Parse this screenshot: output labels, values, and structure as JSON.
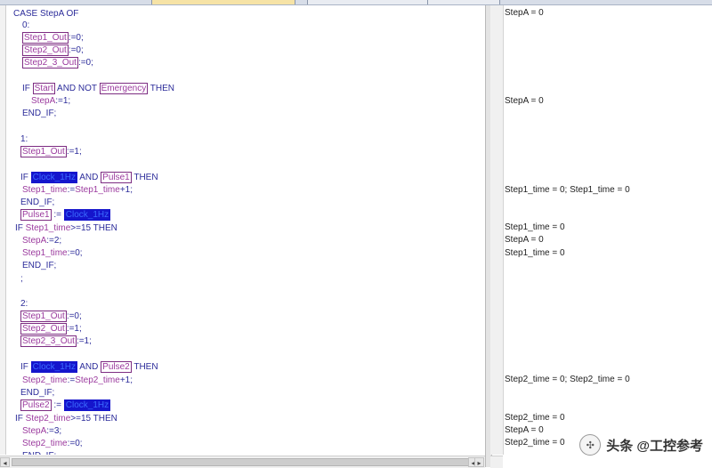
{
  "code_lines": [
    {
      "text": "CASE StepA OF"
    },
    {
      "text": "0:"
    },
    {
      "parts": [
        {
          "t": "Step1_Out",
          "c": "boxed"
        },
        {
          "t": ":=0;",
          "c": "kw"
        }
      ]
    },
    {
      "parts": [
        {
          "t": "Step2_Out",
          "c": "boxed"
        },
        {
          "t": ":=0;",
          "c": "kw"
        }
      ]
    },
    {
      "parts": [
        {
          "t": "Step2_3_Out",
          "c": "boxed"
        },
        {
          "t": ":=0;",
          "c": "kw"
        }
      ]
    },
    {
      "parts": [
        {
          "t": "IF ",
          "c": "kw"
        },
        {
          "t": "Start",
          "c": "boxed"
        },
        {
          "t": " AND NOT ",
          "c": "kw"
        },
        {
          "t": "Emergency",
          "c": "boxed"
        },
        {
          "t": " THEN",
          "c": "kw"
        }
      ]
    },
    {
      "parts": [
        {
          "t": "StepA",
          "c": "var"
        },
        {
          "t": ":=1;",
          "c": "kw"
        }
      ]
    },
    {
      "text": "END_IF;"
    },
    {
      "text": "1:"
    },
    {
      "parts": [
        {
          "t": "Step1_Out",
          "c": "boxed"
        },
        {
          "t": ":=1;",
          "c": "kw"
        }
      ]
    },
    {
      "parts": [
        {
          "t": "IF ",
          "c": "kw"
        },
        {
          "t": "Clock_1Hz",
          "c": "hl"
        },
        {
          "t": " AND ",
          "c": "kw"
        },
        {
          "t": "Pulse1",
          "c": "boxed"
        },
        {
          "t": " THEN",
          "c": "kw"
        }
      ]
    },
    {
      "parts": [
        {
          "t": "Step1_time",
          "c": "var"
        },
        {
          "t": ":=",
          "c": "kw"
        },
        {
          "t": "Step1_time",
          "c": "var"
        },
        {
          "t": "+1;",
          "c": "kw"
        }
      ]
    },
    {
      "text": "END_IF;"
    },
    {
      "parts": [
        {
          "t": "Pulse1",
          "c": "boxed"
        },
        {
          "t": " := ",
          "c": "kw"
        },
        {
          "t": "Clock_1Hz",
          "c": "hl"
        }
      ]
    },
    {
      "parts": [
        {
          "t": "IF ",
          "c": "kw"
        },
        {
          "t": "Step1_time",
          "c": "var"
        },
        {
          "t": ">=15 THEN",
          "c": "kw"
        }
      ]
    },
    {
      "parts": [
        {
          "t": "StepA",
          "c": "var"
        },
        {
          "t": ":=2;",
          "c": "kw"
        }
      ]
    },
    {
      "parts": [
        {
          "t": "Step1_time",
          "c": "var"
        },
        {
          "t": ":=0;",
          "c": "kw"
        }
      ]
    },
    {
      "text": "END_IF;"
    },
    {
      "text": ";"
    },
    {
      "text": "2:"
    },
    {
      "parts": [
        {
          "t": "Step1_Out",
          "c": "boxed"
        },
        {
          "t": ":=0;",
          "c": "kw"
        }
      ]
    },
    {
      "parts": [
        {
          "t": "Step2_Out",
          "c": "boxed"
        },
        {
          "t": ":=1;",
          "c": "kw"
        }
      ]
    },
    {
      "parts": [
        {
          "t": "Step2_3_Out",
          "c": "boxed"
        },
        {
          "t": ":=1;",
          "c": "kw"
        }
      ]
    },
    {
      "parts": [
        {
          "t": "IF ",
          "c": "kw"
        },
        {
          "t": "Clock_1Hz",
          "c": "hl"
        },
        {
          "t": " AND ",
          "c": "kw"
        },
        {
          "t": "Pulse2",
          "c": "boxed"
        },
        {
          "t": " THEN",
          "c": "kw"
        }
      ]
    },
    {
      "parts": [
        {
          "t": "Step2_time",
          "c": "var"
        },
        {
          "t": ":=",
          "c": "kw"
        },
        {
          "t": "Step2_time",
          "c": "var"
        },
        {
          "t": "+1;",
          "c": "kw"
        }
      ]
    },
    {
      "text": "END_IF;"
    },
    {
      "parts": [
        {
          "t": "Pulse2",
          "c": "boxed"
        },
        {
          "t": " := ",
          "c": "kw"
        },
        {
          "t": "Clock_1Hz",
          "c": "hl"
        }
      ]
    },
    {
      "parts": [
        {
          "t": "IF ",
          "c": "kw"
        },
        {
          "t": "Step2_time",
          "c": "var"
        },
        {
          "t": ">=15 THEN",
          "c": "kw"
        }
      ]
    },
    {
      "parts": [
        {
          "t": "StepA",
          "c": "var"
        },
        {
          "t": ":=3;",
          "c": "kw"
        }
      ]
    },
    {
      "parts": [
        {
          "t": "Step2_time",
          "c": "var"
        },
        {
          "t": ":=0;",
          "c": "kw"
        }
      ]
    },
    {
      "text": "END_IF;"
    }
  ],
  "watch_lines": [
    "StepA = 0",
    "StepA = 0",
    "Step1_time = 0; Step1_time = 0",
    "Step1_time = 0",
    "StepA = 0",
    "Step1_time = 0",
    "Step2_time = 0; Step2_time = 0",
    "Step2_time = 0",
    "StepA = 0",
    "Step2_time = 0"
  ],
  "watermark": {
    "text": "头条 @工控参考"
  },
  "icons": {
    "scroll_left": "◂",
    "scroll_right": "▸",
    "watermark_icon": "✣"
  }
}
